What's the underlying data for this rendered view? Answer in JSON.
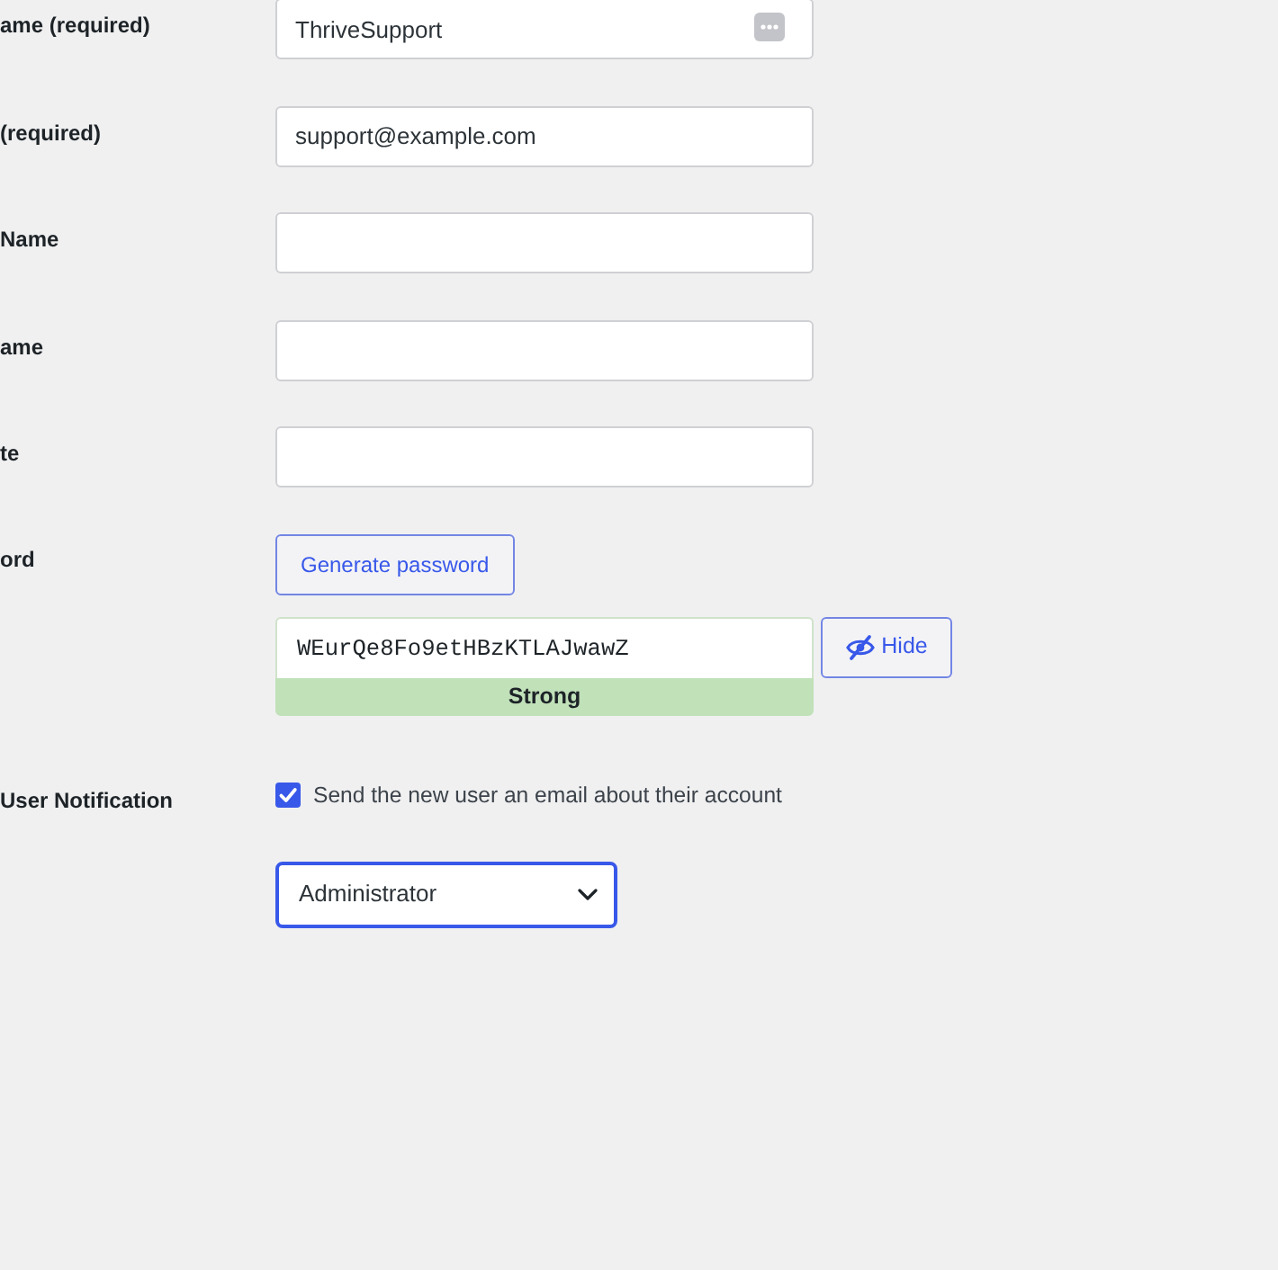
{
  "user_form": {
    "rows": [
      {
        "kind": "text",
        "label": "ame (required)",
        "value": "ThriveSupport",
        "autofill_icon": true
      },
      {
        "kind": "text",
        "label": "(required)",
        "value": "support@example.com"
      },
      {
        "kind": "text",
        "label": "Name"
      },
      {
        "kind": "text",
        "label": "ame"
      },
      {
        "kind": "text",
        "label": "te"
      },
      {
        "kind": "button",
        "label": "ord",
        "button": "Generate password"
      },
      {
        "kind": "password",
        "value": "WEurQe8Fo9etHBzKTLAJwawZ",
        "strength": "Strong",
        "toggle": "Hide"
      },
      {
        "kind": "checkbox",
        "label": "User Notification",
        "text": "Send the new user an email about their account",
        "checked": true
      },
      {
        "kind": "select",
        "value": "Administrator",
        "focused": true
      }
    ]
  }
}
